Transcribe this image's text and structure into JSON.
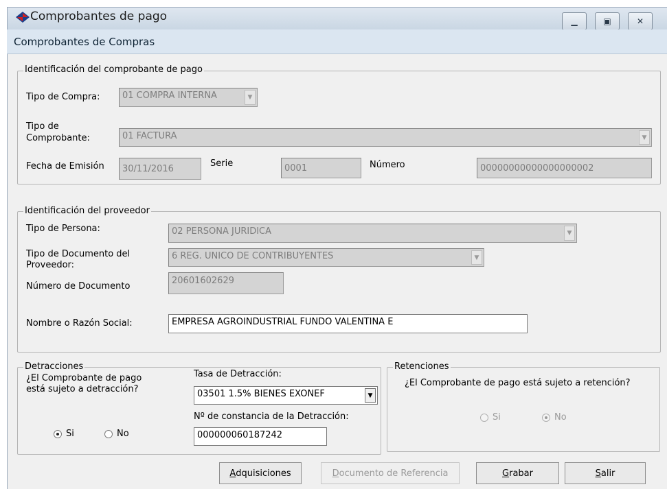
{
  "window": {
    "title": "Comprobantes de pago",
    "minimize_glyph": "▁",
    "maximize_glyph": "▣",
    "close_glyph": "✕"
  },
  "header": {
    "subtitle": "Comprobantes de Compras"
  },
  "comprobante": {
    "legend": "Identificación del comprobante de pago",
    "tipo_compra_label": "Tipo de Compra:",
    "tipo_compra_value": "01 COMPRA INTERNA",
    "tipo_comprobante_label_1": "Tipo de",
    "tipo_comprobante_label_2": "Comprobante:",
    "tipo_comprobante_value": "01 FACTURA",
    "fecha_label": "Fecha de Emisión",
    "fecha_value": "30/11/2016",
    "serie_label": "Serie",
    "serie_value": "0001",
    "numero_label": "Número",
    "numero_value": "00000000000000000002"
  },
  "proveedor": {
    "legend": "Identificación del proveedor",
    "tipo_persona_label": "Tipo de Persona:",
    "tipo_persona_value": "02 PERSONA JURIDICA",
    "tipo_documento_label_1": "Tipo de Documento del",
    "tipo_documento_label_2": "Proveedor:",
    "tipo_documento_value": "6 REG. UNICO DE CONTRIBUYENTES",
    "numero_documento_label": "Número de Documento",
    "numero_documento_value": "20601602629",
    "nombre_label": "Nombre o Razón Social:",
    "nombre_value": "EMPRESA AGROINDUSTRIAL FUNDO VALENTINA E"
  },
  "detracciones": {
    "legend": "Detracciones",
    "question_1": "¿El Comprobante de pago",
    "question_2": "está sujeto a detracción?",
    "si_label": "Si",
    "no_label": "No",
    "selected": "Si",
    "tasa_label": "Tasa de Detracción:",
    "tasa_value": "03501   1.5% BIENES EXONEF",
    "constancia_label": "Nº de constancia de la Detracción:",
    "constancia_value": "000000060187242"
  },
  "retenciones": {
    "legend": "Retenciones",
    "question": "¿El Comprobante de pago está sujeto a retención?",
    "si_label": "Si",
    "no_label": "No",
    "selected": "No"
  },
  "buttons": {
    "adquisiciones_mnemonic": "A",
    "adquisiciones_rest": "dquisiciones",
    "documento_mnemonic": "D",
    "documento_rest": "ocumento de Referencia",
    "grabar_mnemonic": "G",
    "grabar_rest": "rabar",
    "salir_mnemonic": "S",
    "salir_rest": "alir"
  },
  "colors": {
    "header_bg": "#dbe6f1",
    "disabled_field": "#d4d4d4",
    "client_bg": "#f0f0f0"
  }
}
